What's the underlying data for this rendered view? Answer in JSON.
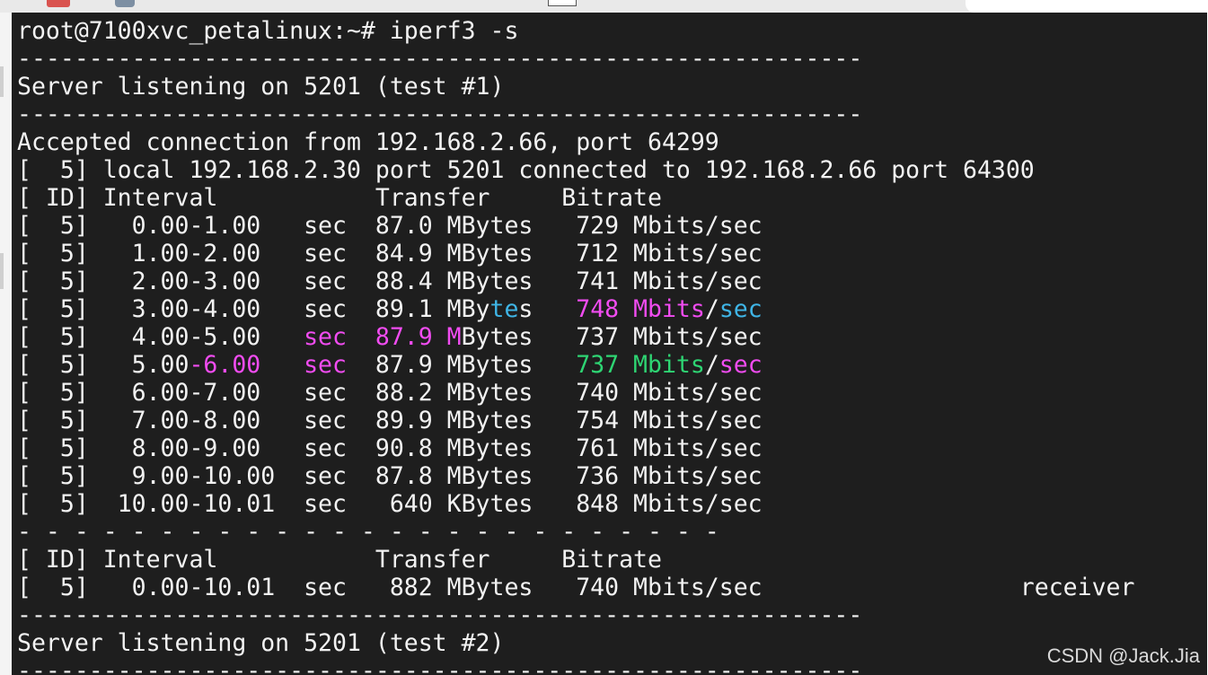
{
  "terminal": {
    "prompt_command": "root@7100xvc_petalinux:~# iperf3 -s",
    "separator": "-----------------------------------------------------------",
    "listening_test1": "Server listening on 5201 (test #1)",
    "accepted": "Accepted connection from 192.168.2.66, port 64299",
    "local_info": "[  5] local 192.168.2.30 port 5201 connected to 192.168.2.66 port 64300",
    "header": "[ ID] Interval           Transfer     Bitrate",
    "rows": [
      {
        "prefix": "[  5]   0.00-1.00   sec  87.0 MBytes   729 Mbits/sec"
      },
      {
        "prefix": "[  5]   1.00-2.00   sec  84.9 MBytes   712 Mbits/sec"
      },
      {
        "prefix": "[  5]   2.00-3.00   sec  88.4 MBytes   741 Mbits/sec"
      },
      {
        "p1": "[  5]   3.00-4.00   sec  89.1 MBy",
        "p2": "te",
        "p3": "s   ",
        "p4": "748 Mbits",
        "p5": "/",
        "p6": "sec"
      },
      {
        "p1": "[  5]   4.00-5.00   ",
        "p2": "sec  87.9 M",
        "p3": "Bytes   737 Mbits/sec"
      },
      {
        "p1": "[  5]   5.00",
        "p2": "-6.00   sec",
        "p3": "  87.9 MBytes   ",
        "p4": "737 Mbits",
        "p5": "/",
        "p6": "sec"
      },
      {
        "prefix": "[  5]   6.00-7.00   sec  88.2 MBytes   740 Mbits/sec"
      },
      {
        "prefix": "[  5]   7.00-8.00   sec  89.9 MBytes   754 Mbits/sec"
      },
      {
        "prefix": "[  5]   8.00-9.00   sec  90.8 MBytes   761 Mbits/sec"
      },
      {
        "prefix": "[  5]   9.00-10.00  sec  87.8 MBytes   736 Mbits/sec"
      },
      {
        "prefix": "[  5]  10.00-10.01  sec   640 KBytes   848 Mbits/sec"
      }
    ],
    "dash_separator": "- - - - - - - - - - - - - - - - - - - - - - - - -",
    "summary_header": "[ ID] Interval           Transfer     Bitrate",
    "summary_row": "[  5]   0.00-10.01  sec   882 MBytes   740 Mbits/sec                  receiver",
    "listening_test2": "Server listening on 5201 (test #2)"
  },
  "watermark": "CSDN @Jack.Jia",
  "colors": {
    "background": "#1e1e1e",
    "text": "#f2f2f2",
    "magenta": "#f14cf1",
    "cyan": "#3fb5e6",
    "green": "#2ed573"
  }
}
